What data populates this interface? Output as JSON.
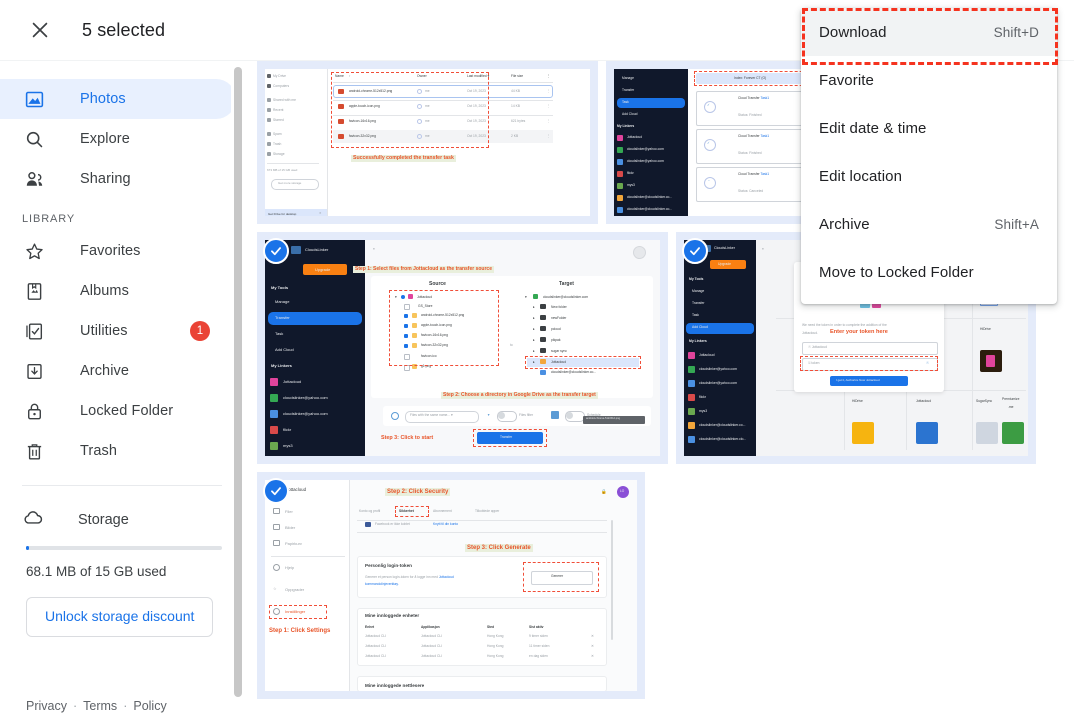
{
  "topbar": {
    "close_icon": "close-icon",
    "selection_label": "5 selected"
  },
  "sidebar": {
    "nav": [
      {
        "label": "Photos",
        "icon": "photo-icon",
        "active": true
      },
      {
        "label": "Explore",
        "icon": "search-icon",
        "active": false
      },
      {
        "label": "Sharing",
        "icon": "people-icon",
        "active": false
      }
    ],
    "section_label": "LIBRARY",
    "library": [
      {
        "label": "Favorites",
        "icon": "star-icon",
        "badge": ""
      },
      {
        "label": "Albums",
        "icon": "album-icon",
        "badge": ""
      },
      {
        "label": "Utilities",
        "icon": "utilities-icon",
        "badge": "1"
      },
      {
        "label": "Archive",
        "icon": "archive-icon",
        "badge": ""
      },
      {
        "label": "Locked Folder",
        "icon": "lock-icon",
        "badge": ""
      },
      {
        "label": "Trash",
        "icon": "trash-icon",
        "badge": ""
      }
    ],
    "storage": {
      "label": "Storage",
      "icon": "cloud-icon",
      "usage_text": "68.1 MB of 15 GB used",
      "usage_percent": 0.45,
      "button_label": "Unlock storage discount"
    },
    "footer": {
      "privacy": "Privacy",
      "terms": "Terms",
      "policy": "Policy",
      "separator": "·"
    }
  },
  "menu": {
    "items": [
      {
        "label": "Download",
        "shortcut": "Shift+D",
        "highlighted": true
      },
      {
        "label": "Favorite",
        "shortcut": "",
        "highlighted": false
      },
      {
        "label": "Edit date & time",
        "shortcut": "",
        "highlighted": false
      },
      {
        "label": "Edit location",
        "shortcut": "",
        "highlighted": false
      },
      {
        "label": "Archive",
        "shortcut": "Shift+A",
        "highlighted": false
      },
      {
        "label": "Move to Locked Folder",
        "shortcut": "",
        "highlighted": false
      }
    ]
  },
  "colors": {
    "accent": "#1a73e8",
    "selection_bg": "#e4ebfa",
    "badge": "#ea4335",
    "annotation_red": "#f04e38",
    "highlight_dash": "#f5331f"
  },
  "photos": {
    "selected_count": 5,
    "items": [
      {
        "name": "google-drive-transfer-complete",
        "selected": true,
        "content": {
          "app": "Google Drive",
          "columns": [
            "Name",
            "Owner",
            "Last modified",
            "File size"
          ],
          "rows": [
            {
              "name": "android-chrome-512x512.png",
              "owner": "me",
              "modified": "Oct 19, 2023",
              "size": "44 KB"
            },
            {
              "name": "apple-touch-icon.png",
              "owner": "me",
              "modified": "Oct 19, 2023",
              "size": "14 KB"
            },
            {
              "name": "favicon-16x16.png",
              "owner": "me",
              "modified": "Oct 19, 2023",
              "size": "621 bytes"
            },
            {
              "name": "favicon-32x32.png",
              "owner": "me",
              "modified": "Oct 19, 2023",
              "size": "2 KB"
            }
          ],
          "nav": [
            "My Drive",
            "Computers",
            "Shared with me",
            "Recent",
            "Starred",
            "Spam",
            "Trash",
            "Storage"
          ],
          "storage_text": "673 MB of 15 GB used",
          "storage_button": "Get more storage",
          "toast": "Get Drive for desktop",
          "annotation": "Successfully completed the transfer task"
        }
      },
      {
        "name": "cloudslinker-task-list",
        "selected": false,
        "content": {
          "app": "CloudsLinker",
          "nav": [
            "Manage",
            "Transfer",
            "Task",
            "Add Cloud"
          ],
          "nav_active": "Task",
          "section": "My Linkers",
          "linkers": [
            "Jottacloud",
            "cloudslinker@yahoo.com",
            "cloudslinker@yahoo.com",
            "flickr",
            "mys3",
            "cloudslinker@cloudslinker.co...",
            "cloudslinker@cloudslinker.co..."
          ],
          "header_row": "Index: Forever CT (O)",
          "tasks": [
            {
              "title": "Cloud Transfer Task1",
              "status": "Status: Finished"
            },
            {
              "title": "Cloud Transfer Task1",
              "status": "Status: Finished"
            },
            {
              "title": "Cloud Transfer Task1",
              "status": "Status: Canceled"
            }
          ]
        }
      },
      {
        "name": "cloudslinker-transfer-setup",
        "selected": true,
        "content": {
          "app": "CloudsLinker",
          "upgrade_button": "Upgrade",
          "section_tools": "My Tools",
          "nav": [
            "Manage",
            "Transfer",
            "Task",
            "Add Cloud"
          ],
          "nav_active": "Transfer",
          "section_linkers": "My Linkers",
          "linkers": [
            "Jottacloud",
            "cloudslinker@yahoo.com",
            "cloudslinker@yahoo.com",
            "flickr",
            "mys3",
            "cloudslinker@cloudslinker.clo..."
          ],
          "source_header": "Source",
          "target_header": "Target",
          "source_root": "Jottacloud",
          "source_files": [
            "GS_Store",
            "android-chrome-512x512.png",
            "apple-touch-icon.png",
            "favicon-16x16.png",
            "favicon-32x32.png",
            "favicon.ico",
            "g1.png"
          ],
          "source_checked": [
            "android-chrome-512x512.png",
            "apple-touch-icon.png",
            "favicon-16x16.png",
            "favicon-32x32.png"
          ],
          "target_root": "cloudslinker@cloudslinker.com",
          "target_folders": [
            "New folder",
            "newFolder",
            "pcloud",
            "pikpak",
            "sugar sync",
            "Jottacloud",
            "cloudslinker@cloudslinker.co..."
          ],
          "target_selected": "Jottacloud",
          "to_label": "to",
          "option_select": "Files with the same name...",
          "toggle_files_filter": "Files filter",
          "toggle_schedule": "Schedule",
          "tooltip": "android-chrome-512x512.png",
          "transfer_button": "Transfer",
          "steps": [
            "Step 1: Select files from Jottacloud as the transfer source",
            "Step 2: Choose a directory in Google Drive as the transfer target",
            "Step 3: Click to start"
          ]
        }
      },
      {
        "name": "cloudslinker-add-token",
        "selected": true,
        "content": {
          "app": "CloudsLinker",
          "upgrade_button": "Upgrade",
          "section_tools": "My Tools",
          "nav": [
            "Manage",
            "Transfer",
            "Task",
            "Add Cloud"
          ],
          "nav_active": "Add Cloud",
          "section_linkers": "My Linkers",
          "linkers": [
            "Jottacloud",
            "cloudslinker@yahoo.com",
            "cloudslinker@yahoo.com",
            "flickr",
            "mys3",
            "cloudslinker@cloudslinker.co...",
            "cloudslinker@cloudslinker.clo..."
          ],
          "dialog_text": "We need the token in order to complete the addition of the Jottacloud.",
          "field_cloud": "Jottacloud",
          "field_token_placeholder": "token",
          "dialog_button": "I get it, Authorize Now Jottacloud",
          "cloud_tiles": [
            "HiDrive",
            "Jottacloud",
            "SugarSync",
            "Premiumize.me"
          ],
          "annotation": "Enter your token here"
        }
      },
      {
        "name": "jottacloud-security-settings",
        "selected": true,
        "content": {
          "app": "Jottacloud",
          "nav": [
            "Filer",
            "Bilder",
            "Papirkurv",
            "Hjelp",
            "Oppgrader",
            "Innstillinger"
          ],
          "nav_active": "Innstillinger",
          "tabs": [
            "Konto og profil",
            "Sikkerhet",
            "Abonnement",
            "Tilkoblede apper"
          ],
          "tab_active": "Sikkerhet",
          "facebook_row": "Facebook er ikke koblet",
          "facebook_link": "Knytt til din konto",
          "token_title": "Personlig login-token",
          "token_desc": "Generer et person login-token for å logge inn med Jottacloud kommandolinjeverktøy.",
          "generate_button": "Generer",
          "devices_title": "Mine innloggede enheter",
          "devices_columns": [
            "Enhet",
            "Applikasjon",
            "Sted",
            "Sist aktiv"
          ],
          "devices_rows": [
            {
              "enhet": "Jottacloud CLI",
              "app": "Jottacloud CLI",
              "sted": "Hong Kong",
              "aktiv": "9 timer siden"
            },
            {
              "enhet": "Jottacloud CLI",
              "app": "Jottacloud CLI",
              "sted": "Hong Kong",
              "aktiv": "11 timer siden"
            },
            {
              "enhet": "Jottacloud CLI",
              "app": "Jottacloud CLI",
              "sted": "Hong Kong",
              "aktiv": "en dag siden"
            }
          ],
          "footer_title": "Mine innloggede nettlesere",
          "steps": [
            "Step 1:  Click Settings",
            "Step 2:  Click Security",
            "Step 3:  Click Generate"
          ]
        }
      }
    ]
  }
}
